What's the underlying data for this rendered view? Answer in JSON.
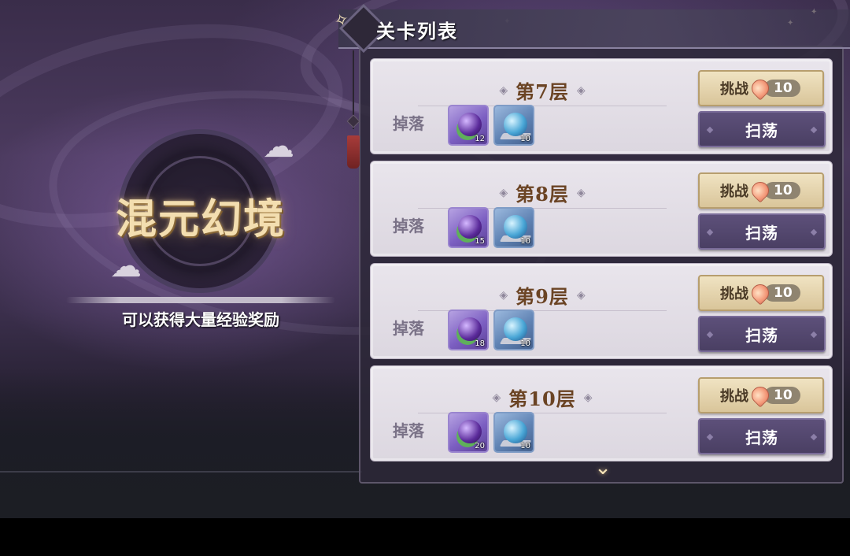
{
  "left": {
    "title": "混元幻境",
    "subtitle": "可以获得大量经验奖励"
  },
  "panel": {
    "title": "关卡列表"
  },
  "drop_label": "掉落",
  "levels": [
    {
      "name": "第7层",
      "items": [
        {
          "icon": "purple-orb-icon",
          "count": "12"
        },
        {
          "icon": "blue-crystal-icon",
          "count": "10"
        }
      ],
      "challenge_label": "挑战",
      "cost": "10",
      "sweep_label": "扫荡"
    },
    {
      "name": "第8层",
      "items": [
        {
          "icon": "purple-orb-icon",
          "count": "15"
        },
        {
          "icon": "blue-crystal-icon",
          "count": "10"
        }
      ],
      "challenge_label": "挑战",
      "cost": "10",
      "sweep_label": "扫荡"
    },
    {
      "name": "第9层",
      "items": [
        {
          "icon": "purple-orb-icon",
          "count": "18"
        },
        {
          "icon": "blue-crystal-icon",
          "count": "10"
        }
      ],
      "challenge_label": "挑战",
      "cost": "10",
      "sweep_label": "扫荡"
    },
    {
      "name": "第10层",
      "items": [
        {
          "icon": "purple-orb-icon",
          "count": "20"
        },
        {
          "icon": "blue-crystal-icon",
          "count": "10"
        }
      ],
      "challenge_label": "挑战",
      "cost": "10",
      "sweep_label": "扫荡"
    }
  ],
  "icons": {
    "cost_currency": "peach-icon",
    "scroll_more": "chevron-down-icon"
  },
  "colors": {
    "level_name": "#6b4424",
    "challenge_button": "#e6d5ad",
    "sweep_button": "#54476e",
    "title_glow": "#f3deb0"
  }
}
